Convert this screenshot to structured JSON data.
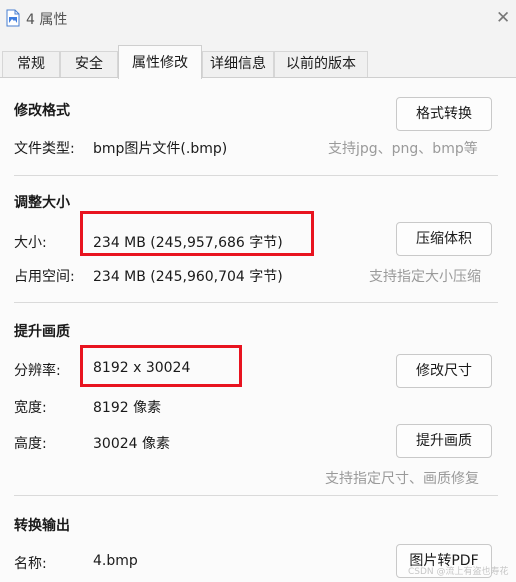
{
  "window": {
    "title": "4 属性",
    "close_glyph": "✕"
  },
  "tabs": [
    {
      "label": "常规"
    },
    {
      "label": "安全"
    },
    {
      "label": "属性修改"
    },
    {
      "label": "详细信息"
    },
    {
      "label": "以前的版本"
    }
  ],
  "format": {
    "title": "修改格式",
    "file_type_label": "文件类型:",
    "file_type_value": "bmp图片文件(.bmp)",
    "button": "格式转换",
    "hint": "支持jpg、png、bmp等"
  },
  "resize": {
    "title": "调整大小",
    "size_label": "大小:",
    "size_value": "234 MB (245,957,686 字节)",
    "disk_label": "占用空间:",
    "disk_value": "234 MB (245,960,704 字节)",
    "button": "压缩体积",
    "hint": "支持指定大小压缩"
  },
  "quality": {
    "title": "提升画质",
    "resolution_label": "分辨率:",
    "resolution_value": "8192 x 30024",
    "width_label": "宽度:",
    "width_value": "8192 像素",
    "height_label": "高度:",
    "height_value": "30024 像素",
    "resize_button": "修改尺寸",
    "enhance_button": "提升画质",
    "hint": "支持指定尺寸、画质修复"
  },
  "convert": {
    "title": "转换输出",
    "name_label": "名称:",
    "name_value": "4.bmp",
    "button": "图片转PDF"
  },
  "watermark": "CSDN @流上有盗也寿花",
  "colors": {
    "highlight": "#e8131f",
    "hint": "#9a9a9a"
  }
}
